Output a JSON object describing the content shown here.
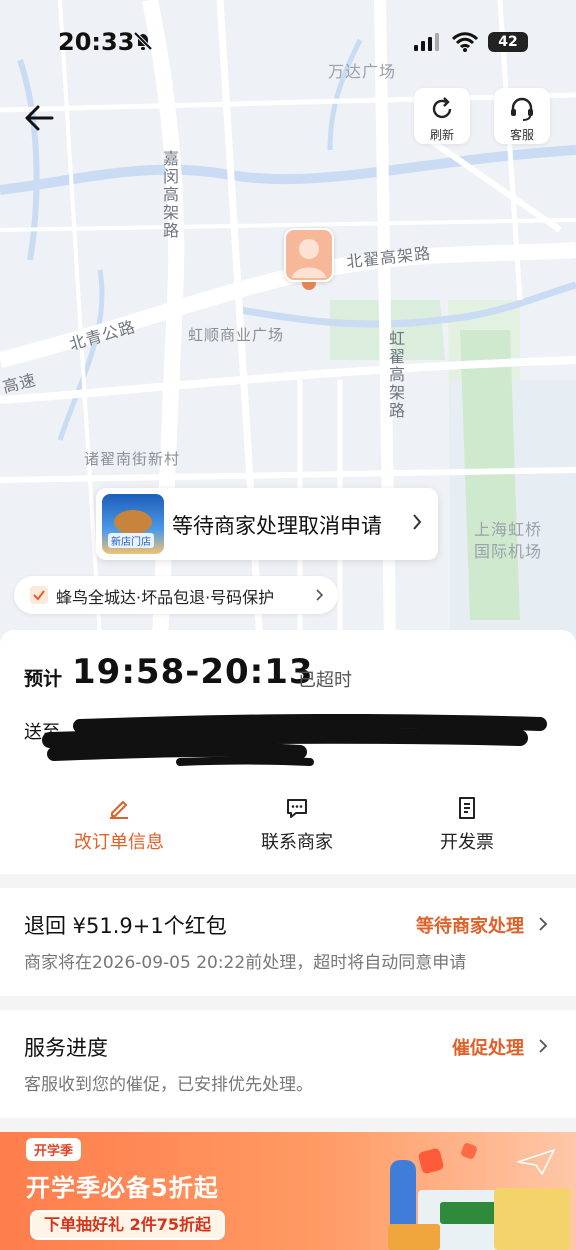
{
  "status_bar": {
    "time": "20:33",
    "battery": "42"
  },
  "map": {
    "labels": {
      "wanda": "万达广场",
      "jiamin": "嘉闵高架路",
      "beizhai": "北翟高架路",
      "hongshun": "虹顺商业广场",
      "hongzhai": "虹翟高架路",
      "beiqing": "北青公路",
      "gaosu": "高速",
      "zhuzhai": "诸翟南街新村",
      "airport1": "上海虹桥",
      "airport2": "国际机场"
    }
  },
  "top_buttons": {
    "refresh": "刷新",
    "service": "客服"
  },
  "cancel_card": {
    "text": "等待商家处理取消申请",
    "thumb_tag": "新店门店"
  },
  "guarantee": {
    "text": "蜂鸟全城达·坏品包退·号码保护"
  },
  "delivery": {
    "eta_label": "预计",
    "eta_time": "19:58-20:13",
    "eta_note": "已超时",
    "address_label": "送至"
  },
  "actions": [
    {
      "label": "改订单信息",
      "icon": "edit-icon"
    },
    {
      "label": "联系商家",
      "icon": "chat-icon"
    },
    {
      "label": "开发票",
      "icon": "invoice-icon"
    }
  ],
  "refund": {
    "title": "退回 ¥51.9+1个红包",
    "status": "等待商家处理",
    "desc": "商家将在2026-09-05 20:22前处理，超时将自动同意申请"
  },
  "progress": {
    "title": "服务进度",
    "status": "催促处理",
    "desc": "客服收到您的催促，已安排优先处理。"
  },
  "promo": {
    "tag": "开学季",
    "headline": "开学季必备5折起",
    "cta": "下单抽好礼  2件75折起"
  }
}
